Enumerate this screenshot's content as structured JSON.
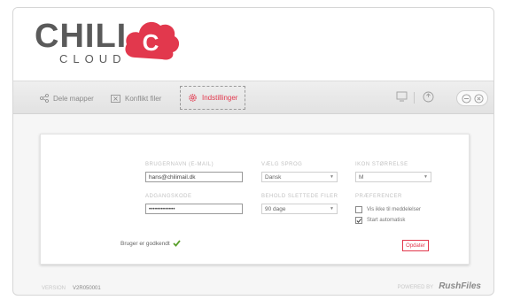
{
  "app": {
    "logo_word": "CHILI",
    "logo_sub": "CLOUD",
    "logo_letter": "C"
  },
  "toolbar": {
    "items": [
      {
        "label": "Dele mapper",
        "icon": "share-icon"
      },
      {
        "label": "Konflikt filer",
        "icon": "conflict-files-icon"
      },
      {
        "label": "Indstillinger",
        "icon": "gear-icon",
        "active": true
      }
    ],
    "right_icons": [
      "monitor-icon",
      "help-icon",
      "minimize-icon",
      "close-icon"
    ]
  },
  "settings": {
    "username_label": "BRUGERNAVN (E-MAIL)",
    "username_value": "hans@chilimail.dk",
    "password_label": "ADGANGSKODE",
    "password_value": "•••••••••••••",
    "language_label": "VÆLG SPROG",
    "language_value": "Dansk",
    "keep_deleted_label": "BEHOLD SLETTEDE FILER",
    "keep_deleted_value": "90 dage",
    "icon_size_label": "IKON STØRRELSE",
    "icon_size_value": "M",
    "preferences_label": "PRÆFERENCER",
    "pref_notifications": "Vis ikke til meddelelser",
    "pref_notifications_checked": false,
    "pref_autostart": "Start automatisk",
    "pref_autostart_checked": true,
    "status_text": "Bruger er godkendt",
    "update_button": "Opdater"
  },
  "footer": {
    "version_label": "VERSION",
    "version_value": "V2R050001",
    "powered_label": "POWERED BY",
    "powered_brand": "RushFiles"
  },
  "colors": {
    "accent": "#e2384d",
    "success": "#5aa02c"
  }
}
